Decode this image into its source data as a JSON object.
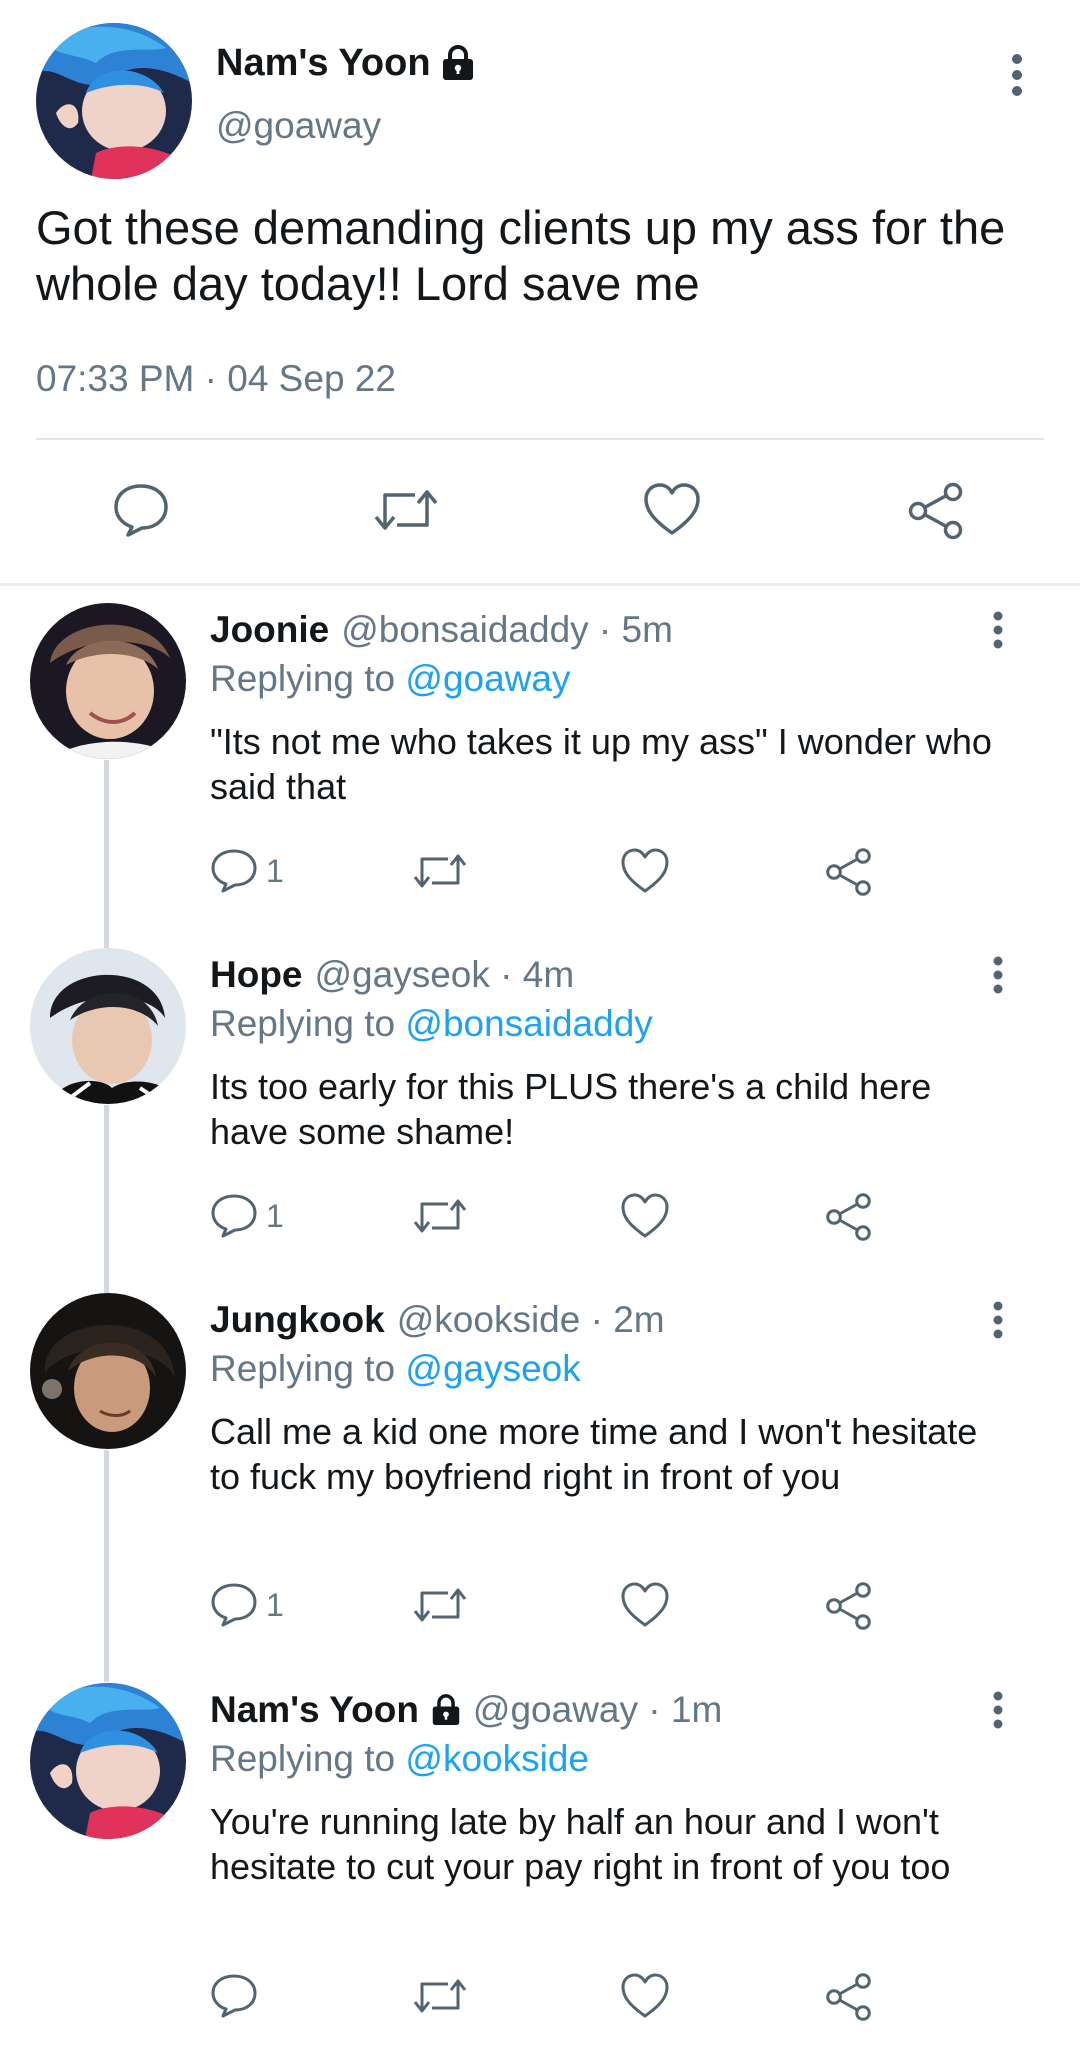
{
  "main_tweet": {
    "name": "Nam's Yoon",
    "handle": "@goaway",
    "text": "Got these demanding clients up my ass for the whole day today!! Lord save me",
    "timestamp": "07:33 PM · 04 Sep 22",
    "icons": [
      "lock-icon",
      "more-vertical-icon",
      "reply-icon",
      "retweet-icon",
      "like-icon",
      "share-icon"
    ]
  },
  "replies": [
    {
      "name": "Joonie",
      "handle": "@bonsaidaddy",
      "time": "5m",
      "replying_label": "Replying to",
      "replying_to": "@goaway",
      "text": "\"Its not me who takes it up my ass\" I wonder who said that",
      "reply_count": "1"
    },
    {
      "name": "Hope",
      "handle": "@gayseok",
      "time": "4m",
      "replying_label": "Replying to",
      "replying_to": "@bonsaidaddy",
      "text": "Its too early for this PLUS there's a child here have some shame!",
      "reply_count": "1"
    },
    {
      "name": "Jungkook",
      "handle": "@kookside",
      "time": "2m",
      "replying_label": "Replying to",
      "replying_to": "@gayseok",
      "text": "Call me a kid one more time and I won't hesitate to fuck my boyfriend right in front of you",
      "reply_count": "1"
    },
    {
      "name": "Nam's Yoon",
      "handle": "@goaway",
      "time": "1m",
      "replying_label": "Replying to",
      "replying_to": "@kookside",
      "text": "You're running late by half an hour and I won't hesitate to cut your pay right in front of you too",
      "reply_count": ""
    }
  ],
  "colors": {
    "text": "#14171a",
    "secondary": "#657786",
    "link": "#1da1f2",
    "divider": "#e1e8ed",
    "thread_line": "#d3d9de",
    "icon": "#536471"
  }
}
